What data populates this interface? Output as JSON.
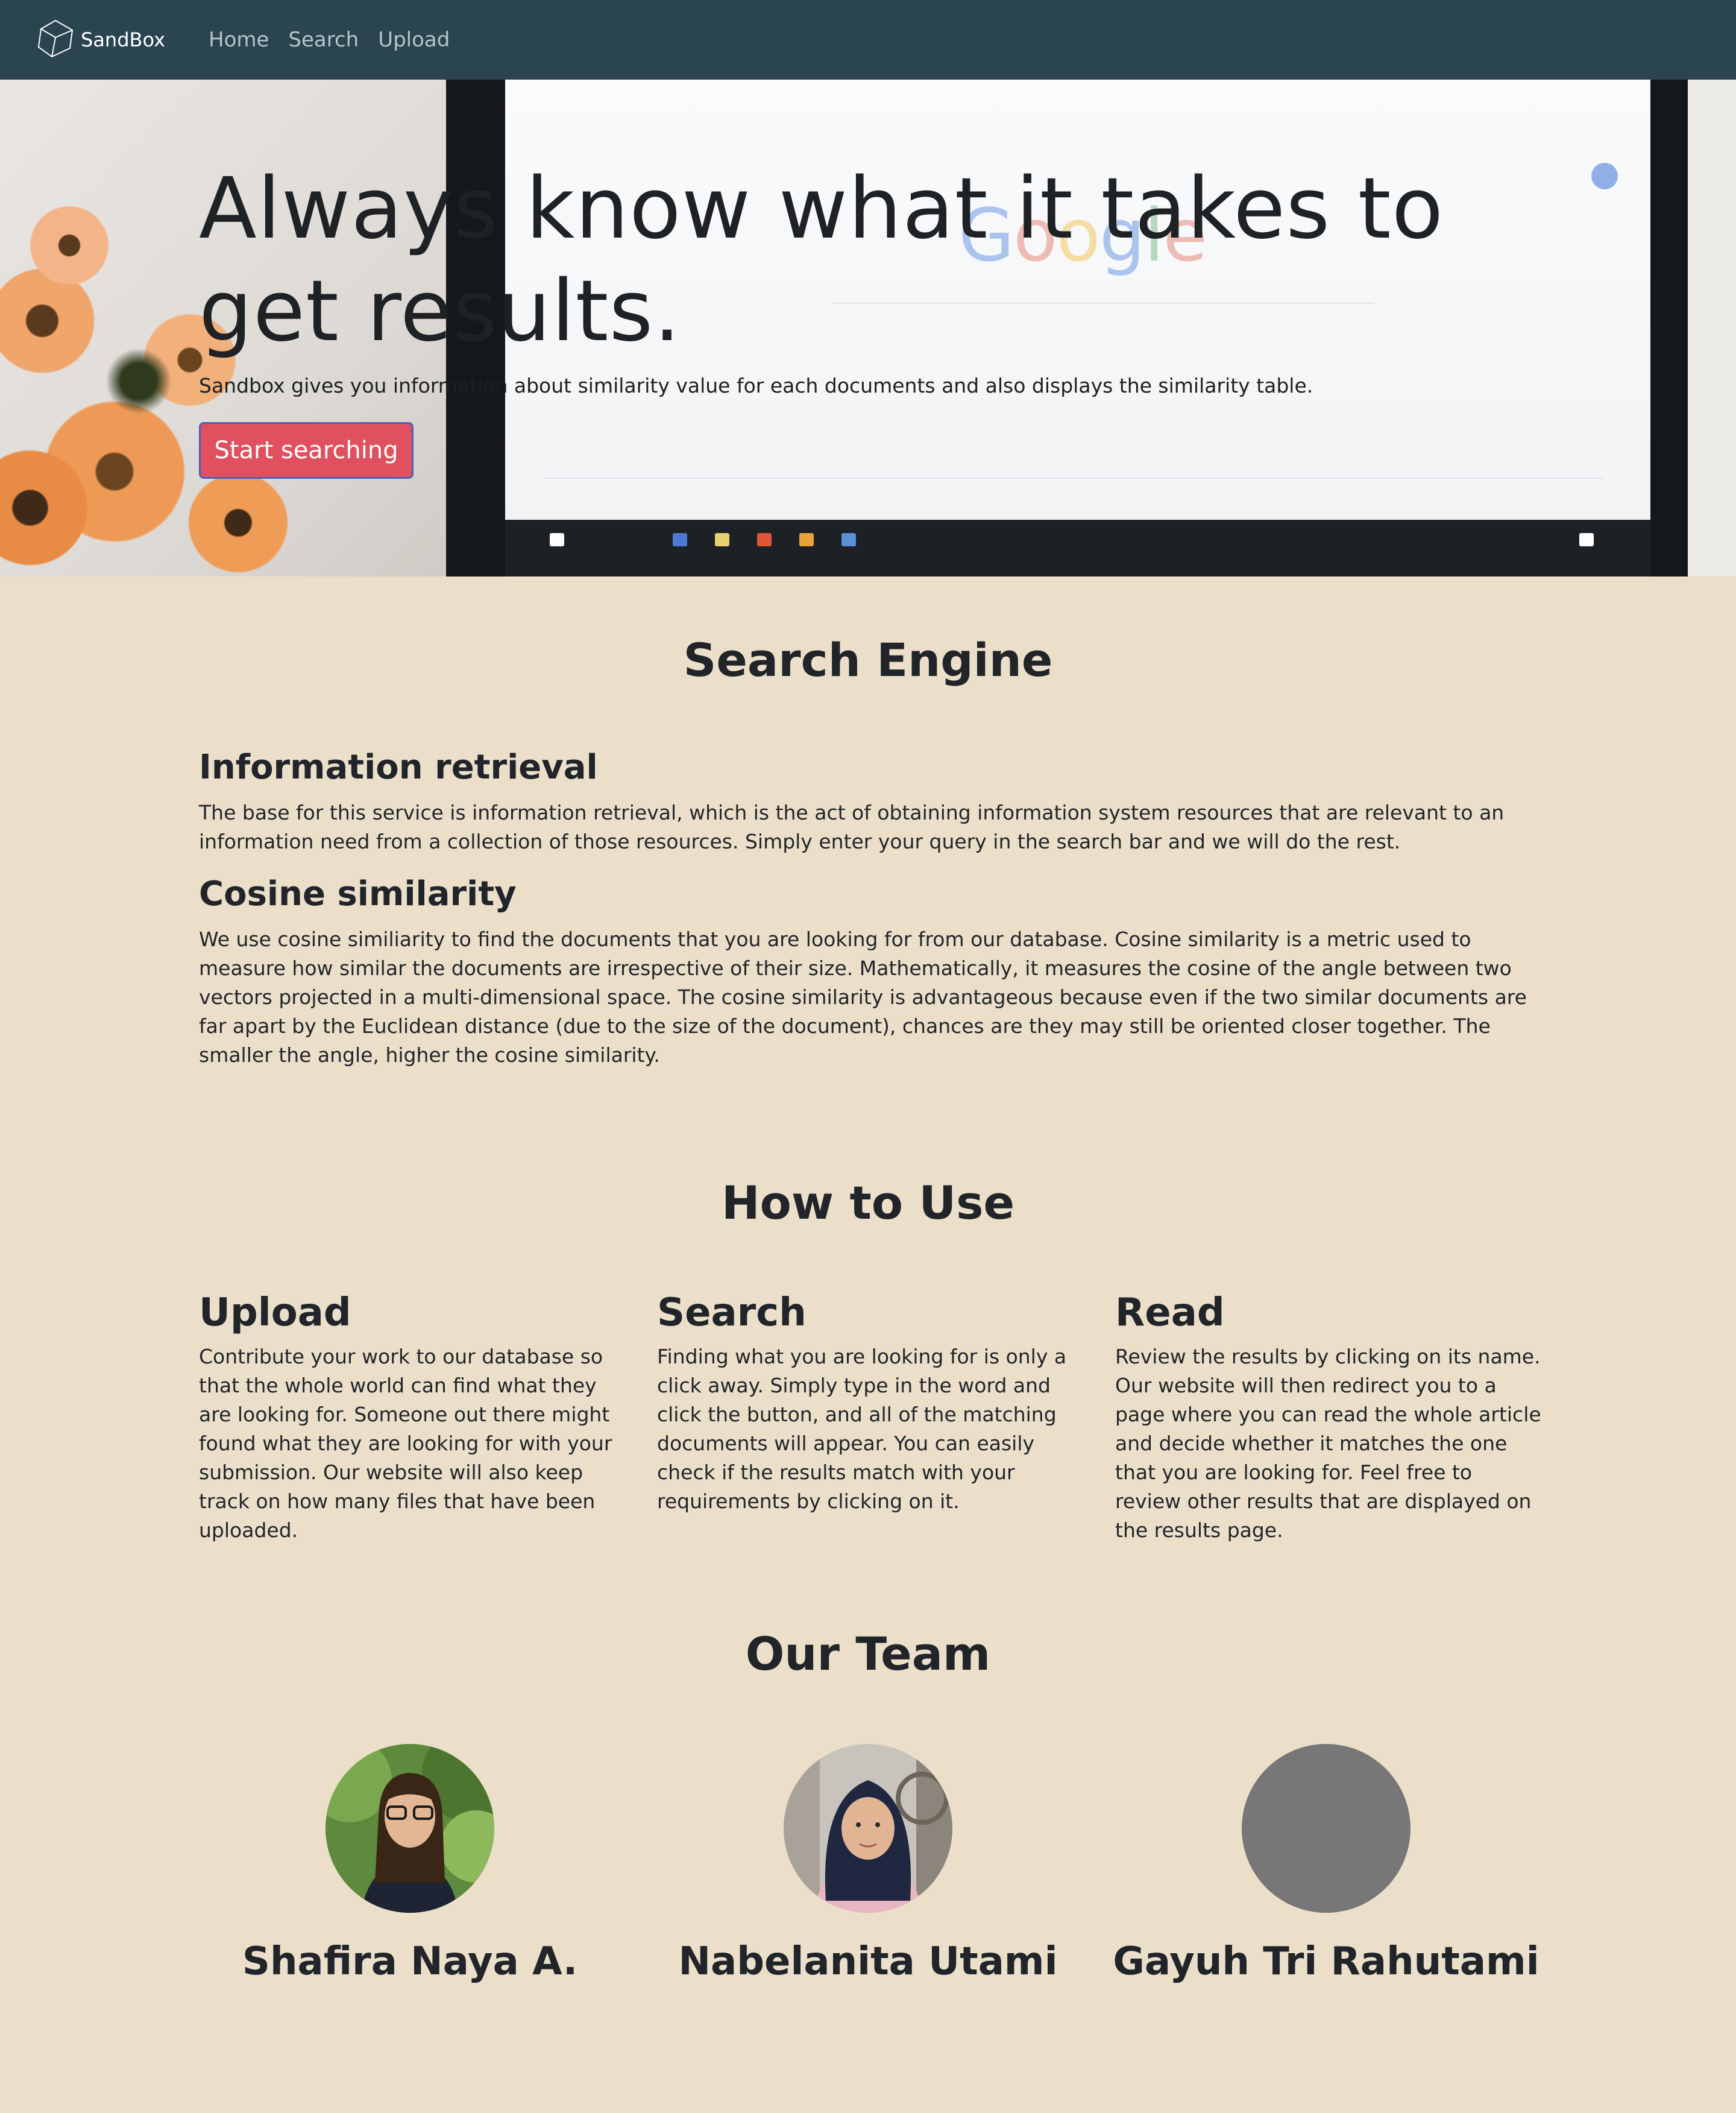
{
  "navbar": {
    "brand": "SandBox",
    "links": [
      "Home",
      "Search",
      "Upload"
    ]
  },
  "hero": {
    "title": "Always know what it takes to get results.",
    "subtitle": "Sandbox gives you information about similarity value for each documents and also displays the similarity table.",
    "button": "Start searching",
    "background_text": "Google"
  },
  "search_engine": {
    "title": "Search Engine",
    "sections": [
      {
        "heading": "Information retrieval",
        "text": "The base for this service is information retrieval, which is the act of obtaining information system resources that are relevant to an information need from a collection of those resources. Simply enter your query in the search bar and we will do the rest."
      },
      {
        "heading": "Cosine similarity",
        "text": "We use cosine similiarity to find the documents that you are looking for from our database. Cosine similarity is a metric used to measure how similar the documents are irrespective of their size. Mathematically, it measures the cosine of the angle between two vectors projected in a multi-dimensional space. The cosine similarity is advantageous because even if the two similar documents are far apart by the Euclidean distance (due to the size of the document), chances are they may still be oriented closer together. The smaller the angle, higher the cosine similarity."
      }
    ]
  },
  "how_to_use": {
    "title": "How to Use",
    "steps": [
      {
        "title": "Upload",
        "text": "Contribute your work to our database so that the whole world can find what they are looking for. Someone out there might found what they are looking for with your submission. Our website will also keep track on how many files that have been uploaded."
      },
      {
        "title": "Search",
        "text": "Finding what you are looking for is only a click away. Simply type in the word and click the button, and all of the matching documents will appear. You can easily check if the results match with your requirements by clicking on it."
      },
      {
        "title": "Read",
        "text": "Review the results by clicking on its name. Our website will then redirect you to a page where you can read the whole article and decide whether it matches the one that you are looking for. Feel free to review other results that are displayed on the results page."
      }
    ]
  },
  "team": {
    "title": "Our Team",
    "members": [
      {
        "name": "Shafira Naya A."
      },
      {
        "name": "Nabelanita Utami"
      },
      {
        "name": "Gayuh Tri Rahutami"
      }
    ]
  },
  "colors": {
    "navbar": "#2a4450",
    "page_background": "#ebdfca",
    "button": "#e0505e",
    "button_border": "#4b5fbf",
    "placeholder_avatar": "#777777"
  },
  "icons": {
    "brand": "cube-logo-icon"
  }
}
